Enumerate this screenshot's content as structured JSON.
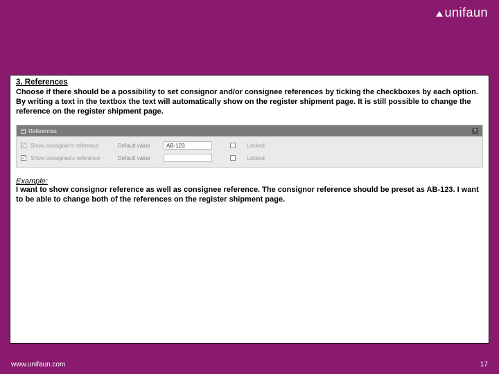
{
  "brand": "unifaun",
  "section_title": "3. References",
  "intro_text": "Choose if there should be a possibility to set consignor and/or consignee references by ticking the checkboxes by each option. By writing a text in the textbox the text will automatically show on the register shipment page. It is still possible to change the reference on the register shipment page.",
  "ui": {
    "panel_title": "References",
    "help_symbol": "?",
    "rows": [
      {
        "show_checked": true,
        "show_label": "Show consignor's reference",
        "default_label": "Default value",
        "value": "AB-123",
        "locked_checked": false,
        "locked_label": "Locked"
      },
      {
        "show_checked": true,
        "show_label": "Show consignee's reference",
        "default_label": "Default value",
        "value": "",
        "locked_checked": false,
        "locked_label": "Locked"
      }
    ]
  },
  "example_label": "Example:",
  "example_text": "I want to show consignor reference as well as consignee reference. The consignor reference should be preset as AB-123. I want to be able to change both of the references on the register shipment page.",
  "footer_url": "www.unifaun.com",
  "page_number": "17"
}
